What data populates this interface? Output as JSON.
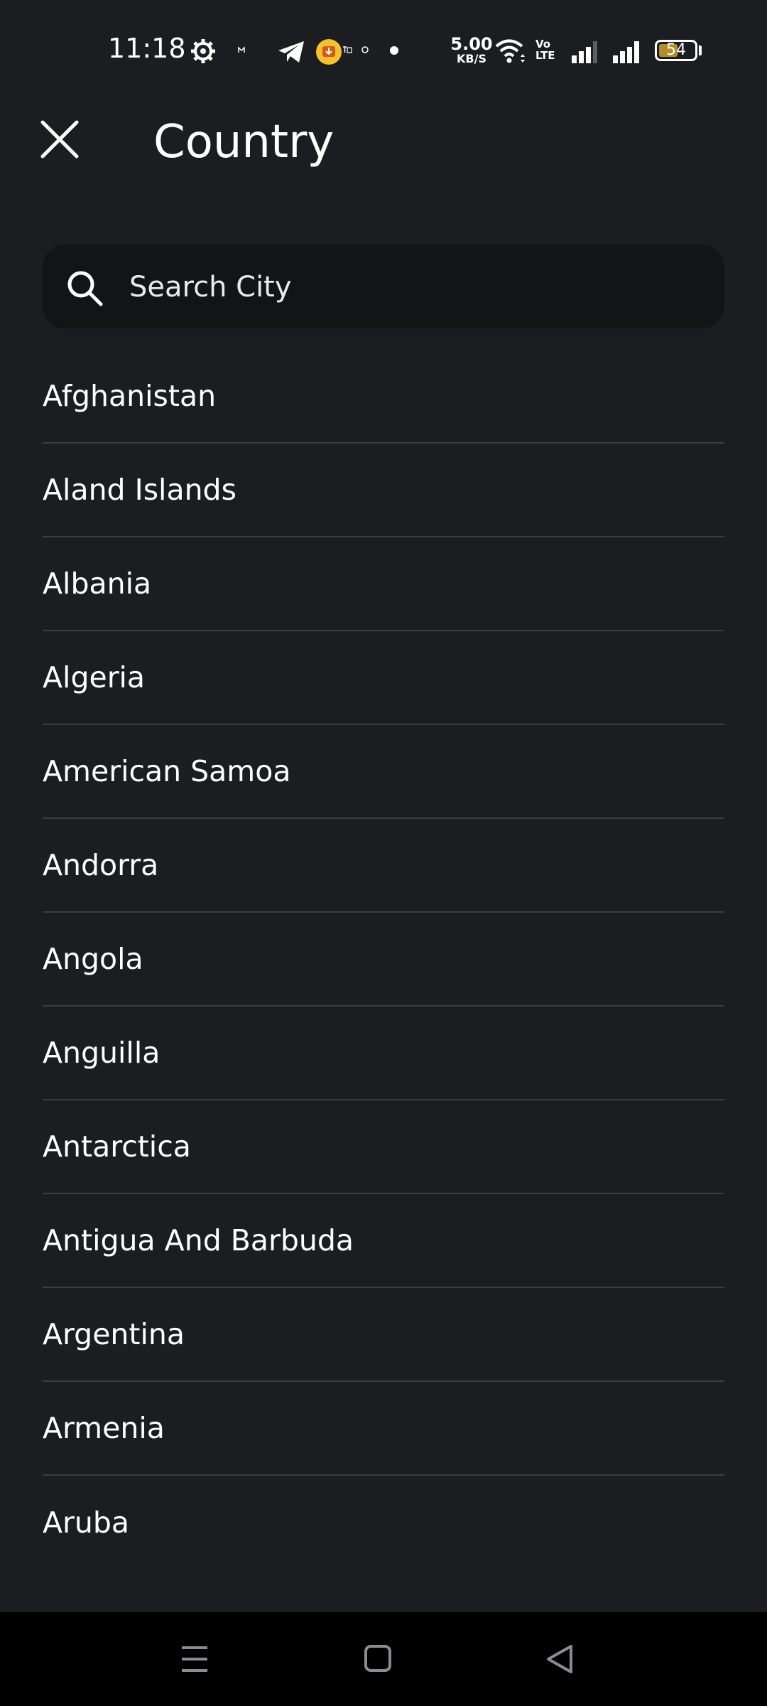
{
  "status_bar": {
    "time": "11:18",
    "net_speed_value": "5.00",
    "net_speed_unit": "KB/S",
    "volte_top": "Vo",
    "volte_bottom": "LTE",
    "battery_level": "54",
    "battery_fraction": 0.54,
    "icons": [
      "settings-gear-icon",
      "small-status-icon",
      "telegram-icon",
      "download-notification-icon",
      "dot-icon",
      "wifi-icon",
      "signal-sim1-icon",
      "signal-sim2-icon",
      "battery-icon"
    ]
  },
  "header": {
    "close_icon": "close-icon",
    "title": "Country"
  },
  "search": {
    "icon": "search-icon",
    "placeholder": "Search City"
  },
  "countries": [
    "Afghanistan",
    "Aland Islands",
    "Albania",
    "Algeria",
    "American Samoa",
    "Andorra",
    "Angola",
    "Anguilla",
    "Antarctica",
    "Antigua And Barbuda",
    "Argentina",
    "Armenia",
    "Aruba"
  ],
  "nav_bar": {
    "icons": [
      "menu-icon",
      "home-icon",
      "back-icon"
    ]
  },
  "colors": {
    "background": "#1b1d20",
    "search_background": "#121416",
    "divider": "#3a3d42",
    "battery_fill": "#b08e2a",
    "notification_yellow": "#f5c12e"
  }
}
